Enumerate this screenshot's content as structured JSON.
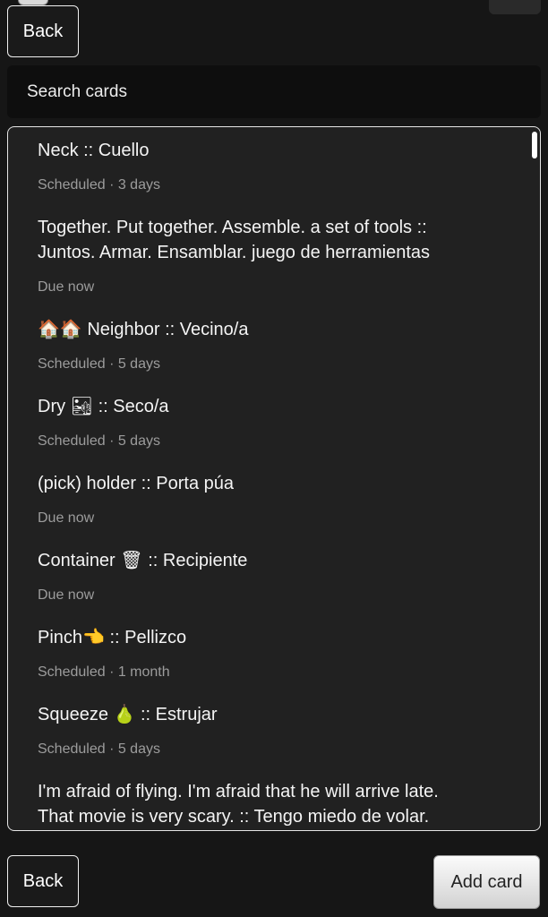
{
  "nav": {
    "back_label": "Back",
    "add_card_label": "Add card"
  },
  "search": {
    "placeholder": "Search cards"
  },
  "cards": [
    {
      "text": "Neck :: Cuello",
      "status": "Scheduled · 3 days"
    },
    {
      "text": "Together. Put together. Assemble. a set of tools ::\nJuntos. Armar. Ensamblar. juego de herramientas",
      "status": "Due now"
    },
    {
      "text": "🏠🏠 Neighbor :: Vecino/a",
      "status": "Scheduled · 5 days"
    },
    {
      "text": "Dry 🏜 :: Seco/a",
      "status": "Scheduled · 5 days"
    },
    {
      "text": "(pick) holder :: Porta púa",
      "status": "Due now"
    },
    {
      "text": "Container 🗑 :: Recipiente",
      "status": "Due now"
    },
    {
      "text": "Pinch👈 :: Pellizco",
      "status": "Scheduled · 1 month"
    },
    {
      "text": "Squeeze 🍐 :: Estrujar",
      "status": "Scheduled · 5 days"
    },
    {
      "text": "I'm afraid of flying. I'm afraid that he will arrive late.\nThat movie is very scary. :: Tengo miedo de volar.",
      "status": ""
    }
  ]
}
